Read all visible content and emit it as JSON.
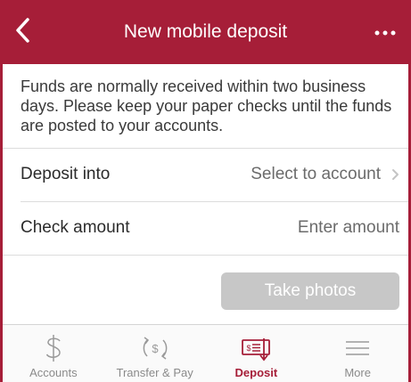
{
  "header": {
    "title": "New mobile deposit",
    "back_icon": "chevron-left-icon",
    "more_icon": "more-dots-icon"
  },
  "info_text": "Funds are normally received within two business days. Please keep your paper checks until the funds are posted to your accounts.",
  "deposit_into": {
    "label": "Deposit into",
    "value": "Select to account",
    "icon": "chevron-right-icon"
  },
  "check_amount": {
    "label": "Check amount",
    "placeholder": "Enter amount"
  },
  "take_photos_label": "Take photos",
  "tabs": [
    {
      "label": "Accounts",
      "icon": "dollar-icon",
      "active": false
    },
    {
      "label": "Transfer & Pay",
      "icon": "transfer-pay-icon",
      "active": false
    },
    {
      "label": "Deposit",
      "icon": "deposit-check-icon",
      "active": true
    },
    {
      "label": "More",
      "icon": "menu-lines-icon",
      "active": false
    }
  ],
  "colors": {
    "brand": "#a61e38",
    "disabled_button": "#c7c7c7",
    "inactive_tab": "#8a8a8a"
  }
}
